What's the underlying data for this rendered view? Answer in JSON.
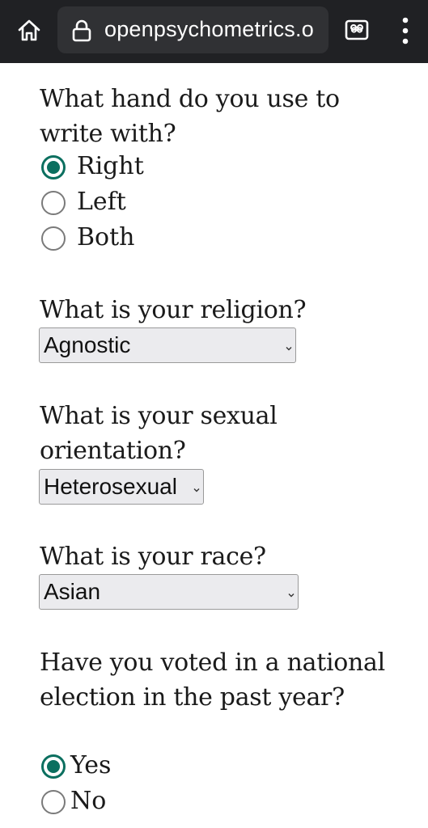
{
  "browser": {
    "url": "openpsychometrics.o",
    "home_icon": "home-icon",
    "lock_icon": "lock-icon",
    "tabs_icon": "tab-switcher-icon",
    "menu_icon": "more-vert-icon"
  },
  "colors": {
    "topbar": "#202124",
    "urlbox": "#303134",
    "radio_accent": "#0b6f5f",
    "select_bg": "#ebebee"
  },
  "form": {
    "q_hand": "What hand do you use to write with?",
    "hand_options": [
      {
        "label": "Right",
        "selected": true
      },
      {
        "label": "Left",
        "selected": false
      },
      {
        "label": "Both",
        "selected": false
      }
    ],
    "q_religion": "What is your religion?",
    "religion_value": "Agnostic",
    "q_orientation": "What is your sexual orientation?",
    "orientation_value": "Heterosexual",
    "q_race": "What is your race?",
    "race_value": "Asian",
    "q_voted": "Have you voted in a national election in the past year?",
    "voted_options": [
      {
        "label": "Yes",
        "selected": true
      },
      {
        "label": "No",
        "selected": false
      }
    ]
  }
}
